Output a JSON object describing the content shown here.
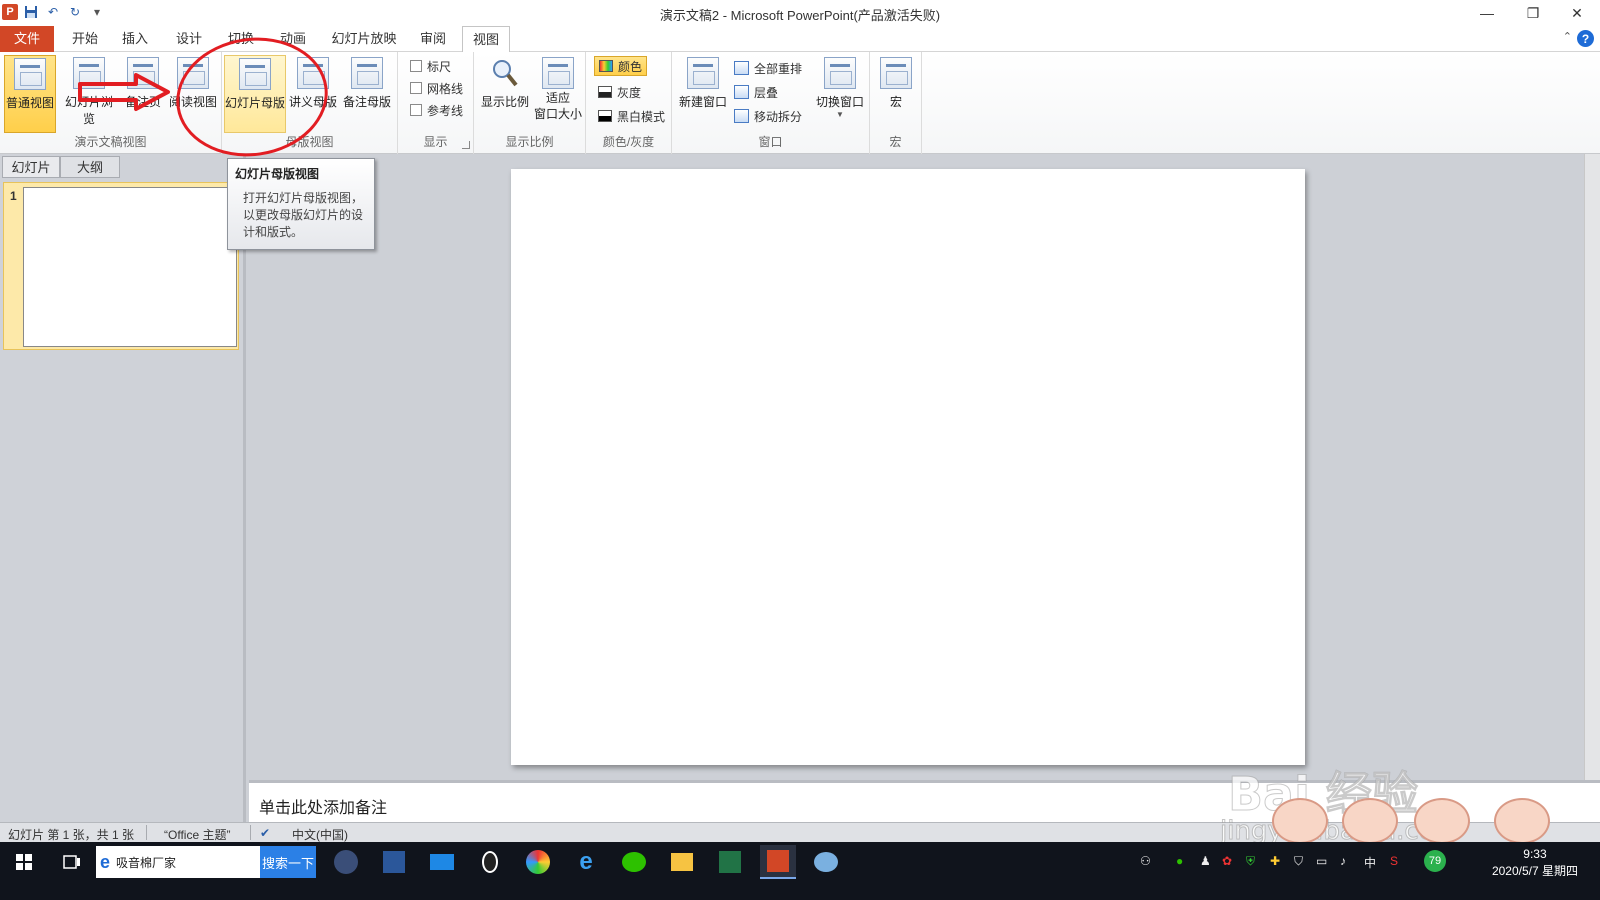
{
  "window": {
    "title": "演示文稿2 - Microsoft PowerPoint(产品激活失败)"
  },
  "quick_access": {
    "app_icon": "P",
    "undo_glyph": "↶",
    "redo_glyph": "↻",
    "dropdown_glyph": "▾"
  },
  "window_controls": {
    "minimize": "—",
    "restore": "❐",
    "close": "✕"
  },
  "menu": {
    "file": "文件",
    "tabs": [
      "开始",
      "插入",
      "设计",
      "切换",
      "动画",
      "幻灯片放映",
      "审阅",
      "视图"
    ],
    "active_tab": "视图",
    "help_glyph": "?",
    "collapse_glyph": "⌃"
  },
  "ribbon": {
    "presentation_views": {
      "label": "演示文稿视图",
      "normal": "普通视图",
      "sorter": "幻灯片浏览",
      "notes_page": "备注页",
      "reading": "阅读视图"
    },
    "master_views": {
      "label": "母版视图",
      "slide_master": "幻灯片母版",
      "handout_master": "讲义母版",
      "notes_master": "备注母版"
    },
    "show": {
      "label": "显示",
      "ruler": "标尺",
      "gridlines": "网格线",
      "guides": "参考线"
    },
    "zoom": {
      "label": "显示比例",
      "zoom": "显示比例",
      "fit_line1": "适应",
      "fit_line2": "窗口大小"
    },
    "color": {
      "label": "颜色/灰度",
      "color": "颜色",
      "grayscale": "灰度",
      "bw": "黑白模式"
    },
    "window": {
      "label": "窗口",
      "new_window": "新建窗口",
      "arrange_all": "全部重排",
      "cascade": "层叠",
      "move_split": "移动拆分",
      "switch_windows": "切换窗口"
    },
    "macros": {
      "label": "宏",
      "macros": "宏"
    }
  },
  "tooltip": {
    "title": "幻灯片母版视图",
    "body": "打开幻灯片母版视图，以更改母版幻灯片的设计和版式。"
  },
  "left_pane": {
    "tab_slides": "幻灯片",
    "tab_outline": "大纲",
    "slide_number": "1"
  },
  "notes": {
    "placeholder": "单击此处添加备注"
  },
  "statusbar": {
    "slide_info": "幻灯片 第 1 张，共 1 张",
    "theme": "“Office 主题”",
    "language": "中文(中国)"
  },
  "watermark": {
    "text": "Bai 经验",
    "sub": "jingyan.baidu.com"
  },
  "taskbar": {
    "search_text": "吸音棉厂家",
    "search_button": "搜索一下",
    "ime": "中",
    "badge": "79",
    "time": "9:33",
    "date": "2020/5/7 星期四"
  },
  "colors": {
    "file_tab": "#d24726",
    "pressed_button": "#ffcf4a",
    "annotation_red": "#e21d22",
    "taskbar": "#10141c"
  }
}
